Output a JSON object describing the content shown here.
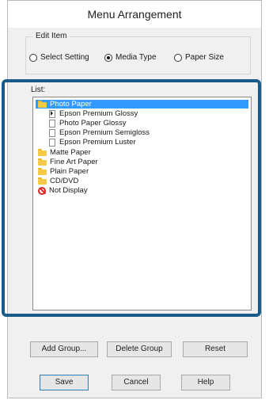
{
  "window": {
    "title": "Menu Arrangement"
  },
  "edit_item": {
    "label": "Edit Item",
    "options": [
      {
        "label": "Select Setting",
        "selected": false
      },
      {
        "label": "Media Type",
        "selected": true
      },
      {
        "label": "Paper Size",
        "selected": false
      }
    ]
  },
  "list": {
    "label": "List:",
    "items": [
      {
        "label": "Photo Paper",
        "icon": "folder-icon",
        "selected": true
      },
      {
        "label": "Epson Premium Glossy",
        "icon": "document-icon"
      },
      {
        "label": "Photo Paper Glossy",
        "icon": "document-icon"
      },
      {
        "label": "Epson Premium Semigloss",
        "icon": "document-icon"
      },
      {
        "label": "Epson Premium Luster",
        "icon": "document-icon"
      },
      {
        "label": "Matte Paper",
        "icon": "folder-icon"
      },
      {
        "label": "Fine Art Paper",
        "icon": "folder-icon"
      },
      {
        "label": "Plain Paper",
        "icon": "folder-icon"
      },
      {
        "label": "CD/DVD",
        "icon": "folder-icon"
      },
      {
        "label": "Not Display",
        "icon": "no-entry-icon"
      }
    ]
  },
  "group_buttons": {
    "add": "Add Group...",
    "delete": "Delete Group",
    "reset": "Reset"
  },
  "footer_buttons": {
    "save": "Save",
    "cancel": "Cancel",
    "help": "Help"
  },
  "colors": {
    "selection": "#3399ff",
    "highlight_frame": "#1a5b8a"
  }
}
